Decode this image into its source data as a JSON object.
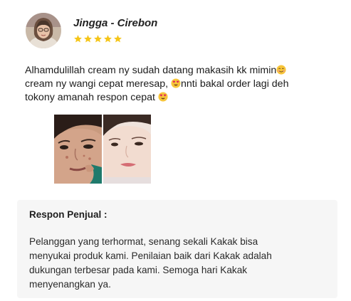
{
  "reviewer": {
    "name": "Jingga - Cirebon",
    "rating": 5
  },
  "review": {
    "line1": "Alhamdulillah cream ny sudah datang makasih kk mimin",
    "line2a": "cream ny wangi cepat meresap, ",
    "line2b": "nnti bakal order lagi deh",
    "line3": "tokony amanah respon cepat "
  },
  "seller_response": {
    "title": "Respon Penjual :",
    "line1": "Pelanggan yang terhormat, senang sekali Kakak bisa",
    "line2": "menyukai produk kami. Penilaian baik dari Kakak adalah",
    "line3": "dukungan terbesar pada kami. Semoga hari Kakak",
    "line4": "menyenangkan ya."
  },
  "icons": {
    "star": "star-icon",
    "smiling_emoji": "smiling-face-emoji",
    "heart_eyes_emoji": "heart-eyes-emoji"
  },
  "colors": {
    "star": "#f5c518",
    "seller_box_bg": "#f6f6f6"
  }
}
